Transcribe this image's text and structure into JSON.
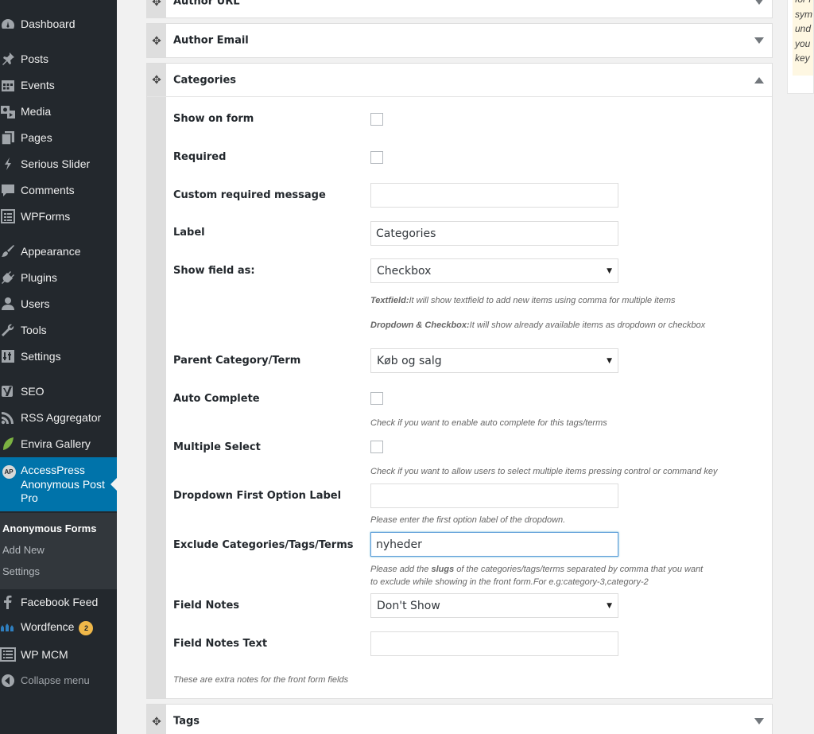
{
  "sidebar": {
    "items": [
      {
        "label": "Dashboard",
        "icon": "dashboard-icon"
      },
      {
        "label": "Posts",
        "icon": "pin-icon"
      },
      {
        "label": "Events",
        "icon": "calendar-icon"
      },
      {
        "label": "Media",
        "icon": "media-icon"
      },
      {
        "label": "Pages",
        "icon": "pages-icon"
      },
      {
        "label": "Serious Slider",
        "icon": "slider-icon"
      },
      {
        "label": "Comments",
        "icon": "comment-icon"
      },
      {
        "label": "WPForms",
        "icon": "form-icon"
      },
      {
        "label": "Appearance",
        "icon": "brush-icon"
      },
      {
        "label": "Plugins",
        "icon": "plugin-icon"
      },
      {
        "label": "Users",
        "icon": "user-icon"
      },
      {
        "label": "Tools",
        "icon": "wrench-icon"
      },
      {
        "label": "Settings",
        "icon": "settings-icon"
      },
      {
        "label": "SEO",
        "icon": "yoast-icon"
      },
      {
        "label": "RSS Aggregator",
        "icon": "rss-icon"
      },
      {
        "label": "Envira Gallery",
        "icon": "leaf-icon"
      },
      {
        "label": "AccessPress Anonymous Post Pro",
        "icon": "ap-icon",
        "badge": "AP"
      },
      {
        "label": "Facebook Feed",
        "icon": "facebook-icon"
      },
      {
        "label": "Wordfence",
        "icon": "wordfence-icon",
        "count": "2"
      },
      {
        "label": "WP MCM",
        "icon": "list-icon"
      },
      {
        "label": "Collapse menu",
        "icon": "collapse-icon"
      }
    ],
    "submenu": [
      {
        "label": "Anonymous Forms"
      },
      {
        "label": "Add New"
      },
      {
        "label": "Settings"
      }
    ]
  },
  "panels": {
    "author_url": {
      "title": "Author URL"
    },
    "author_email": {
      "title": "Author Email"
    },
    "categories": {
      "title": "Categories"
    },
    "tags": {
      "title": "Tags"
    }
  },
  "fields": {
    "show_on_form": {
      "label": "Show on form"
    },
    "required": {
      "label": "Required"
    },
    "custom_required_message": {
      "label": "Custom required message",
      "value": ""
    },
    "label": {
      "label": "Label",
      "value": "Categories"
    },
    "show_field_as": {
      "label": "Show field as:",
      "value": "Checkbox",
      "note1_bold": "Textfield:",
      "note1": "It will show textfield to add new items using comma for multiple items",
      "note2_bold": "Dropdown & Checkbox:",
      "note2": "It will show already available items as dropdown or checkbox"
    },
    "parent_category": {
      "label": "Parent Category/Term",
      "value": "Køb og salg"
    },
    "auto_complete": {
      "label": "Auto Complete",
      "note": "Check if you want to enable auto complete for this tags/terms"
    },
    "multiple_select": {
      "label": "Multiple Select",
      "note": "Check if you want to allow users to select multiple items pressing control or command key"
    },
    "dropdown_first_option": {
      "label": "Dropdown First Option Label",
      "value": "",
      "note": "Please enter the first option label of the dropdown."
    },
    "exclude_terms": {
      "label": "Exclude Categories/Tags/Terms",
      "value": "nyheder",
      "note_pre": "Please add the ",
      "note_bold": "slugs",
      "note_post": " of the categories/tags/terms separated by comma that you want",
      "note_line2": "to exclude while showing in the front form.For e.g:category-3,category-2"
    },
    "field_notes": {
      "label": "Field Notes",
      "value": "Don't Show"
    },
    "field_notes_text": {
      "label": "Field Notes Text",
      "value": "",
      "note": "These are extra notes for the front form fields"
    }
  },
  "help_box": {
    "lines": [
      "for r",
      "sym",
      "und",
      "you",
      "key"
    ]
  },
  "colors": {
    "sidebar_bg": "#23282d",
    "active_bg": "#0073aa",
    "submenu_bg": "#32373c",
    "update_badge": "#f0b849",
    "help_bg": "#fef7e2"
  }
}
